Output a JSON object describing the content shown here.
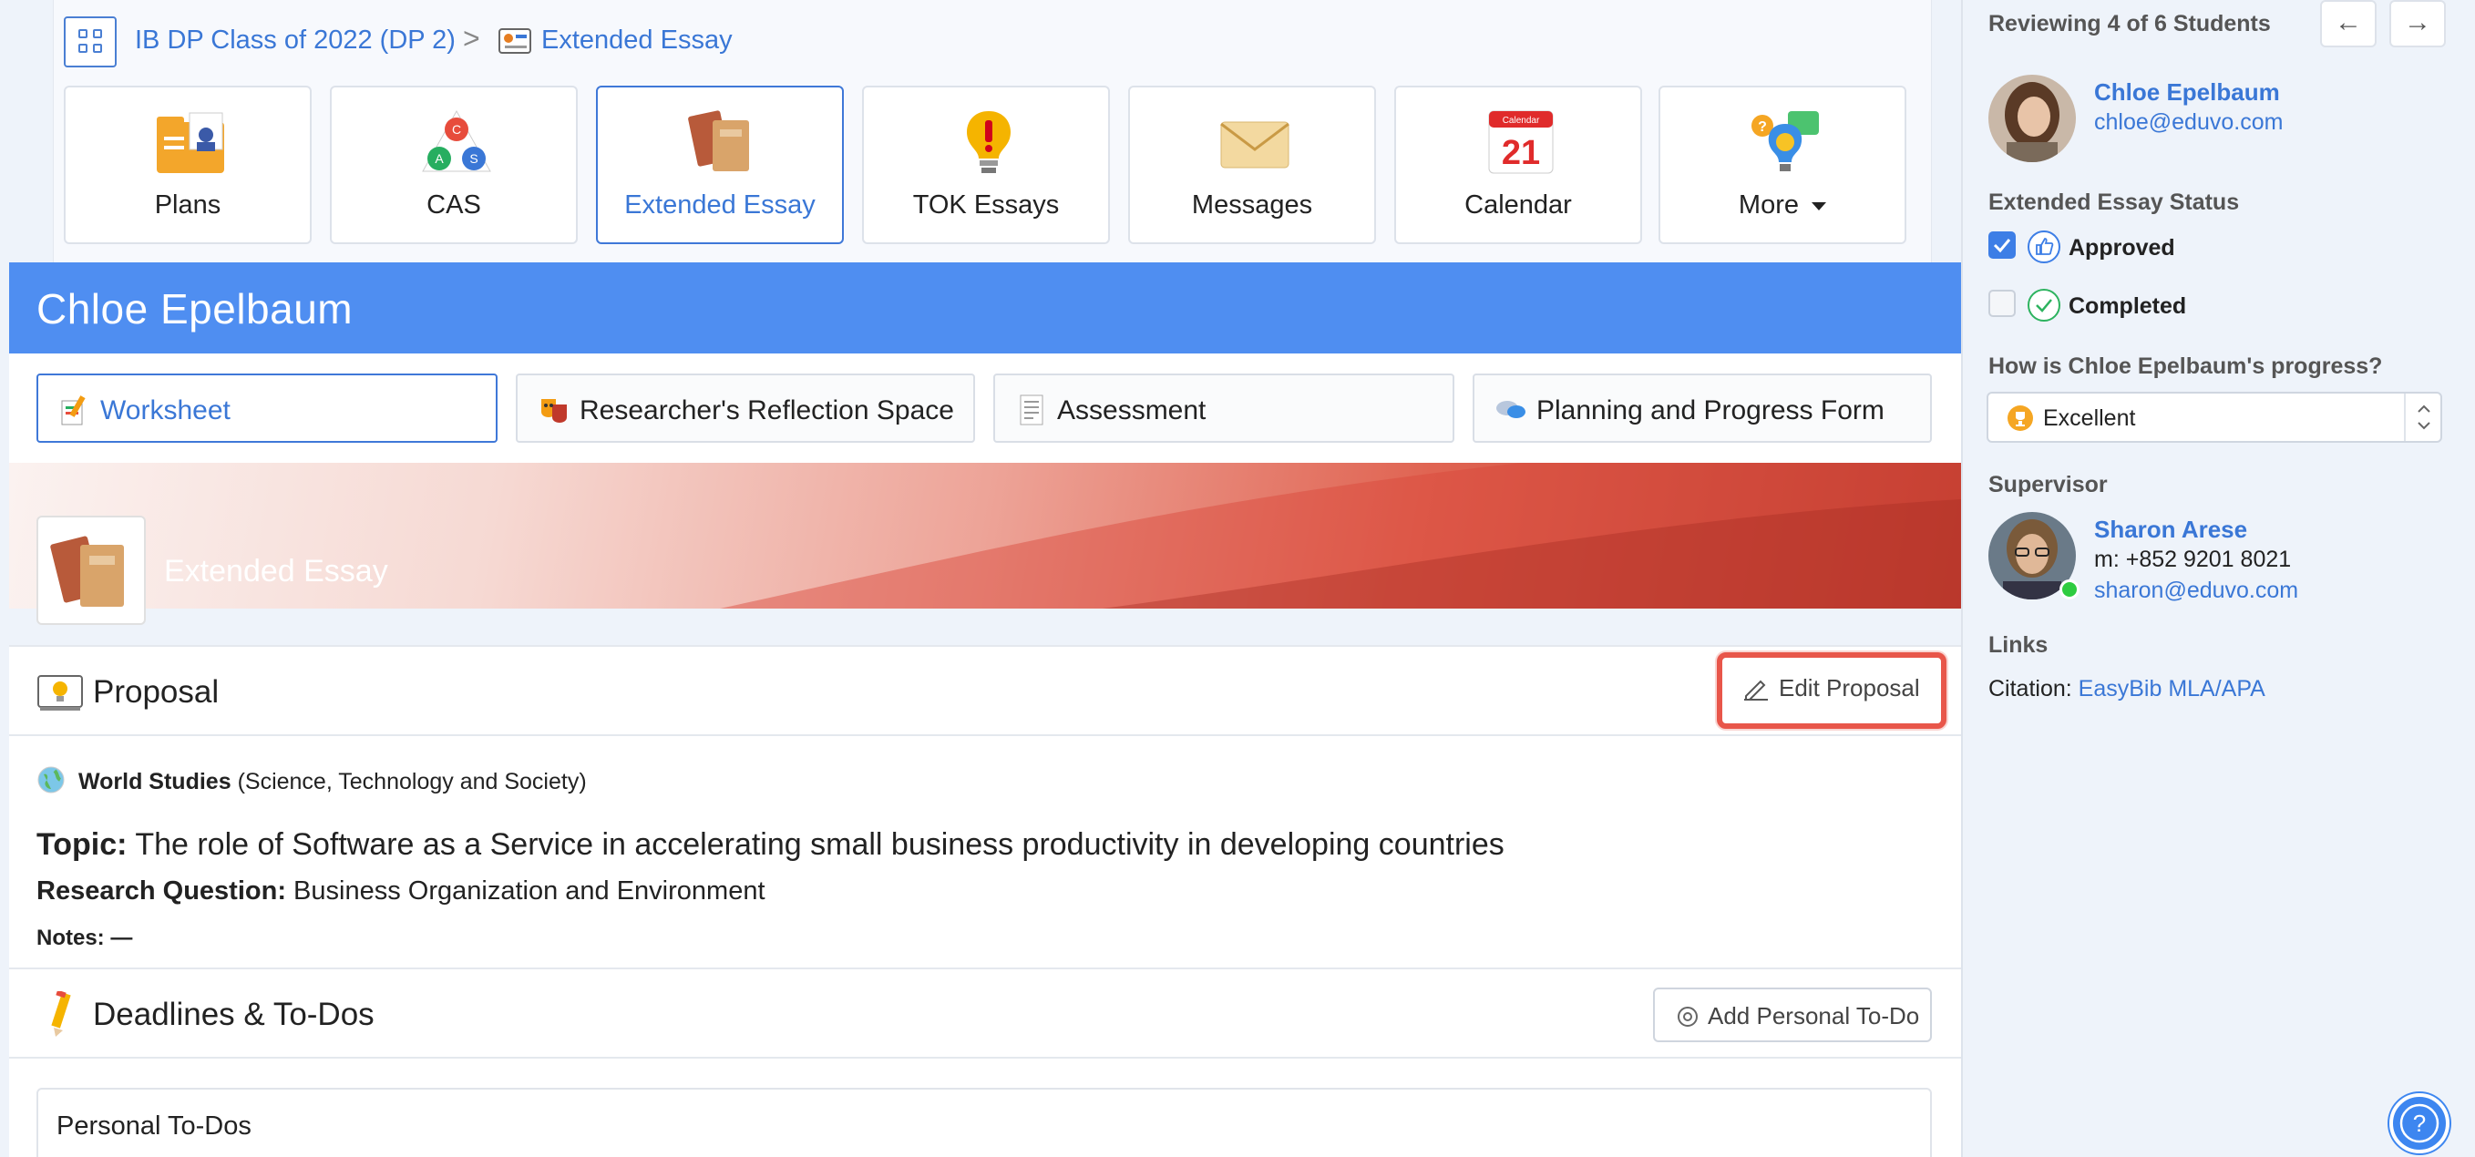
{
  "breadcrumb": {
    "class_name": "IB DP Class of 2022 (DP 2)",
    "current": "Extended Essay",
    "separator": ">"
  },
  "app_tiles": [
    {
      "label": "Plans",
      "icon": "plans-folder-icon"
    },
    {
      "label": "CAS",
      "icon": "cas-triangle-icon",
      "icon_letters": [
        "C",
        "A",
        "S"
      ]
    },
    {
      "label": "Extended Essay",
      "icon": "extended-essay-books-icon",
      "active": true
    },
    {
      "label": "TOK Essays",
      "icon": "lightbulb-exclamation-icon"
    },
    {
      "label": "Messages",
      "icon": "envelope-icon"
    },
    {
      "label": "Calendar",
      "icon": "calendar-icon",
      "icon_text": "21",
      "icon_header": "Calendar"
    },
    {
      "label": "More",
      "icon": "more-apps-icon",
      "has_dropdown": true
    }
  ],
  "student": {
    "name": "Chloe Epelbaum"
  },
  "subtabs": [
    {
      "label": "Worksheet",
      "icon": "worksheet-icon",
      "active": true
    },
    {
      "label": "Researcher's Reflection Space",
      "icon": "reflection-theater-icon"
    },
    {
      "label": "Assessment",
      "icon": "assessment-doc-icon"
    },
    {
      "label": "Planning and Progress Form",
      "icon": "speech-bubbles-icon"
    }
  ],
  "ee_header": {
    "title": "Extended Essay"
  },
  "proposal": {
    "title": "Proposal",
    "edit_label": "Edit Proposal",
    "subject": "World Studies",
    "subject_detail": "(Science, Technology and Society)",
    "topic_label": "Topic:",
    "topic": "The role of Software as a Service in accelerating small business productivity in developing countries",
    "rq_label": "Research Question:",
    "rq": "Business Organization and Environment",
    "notes_label": "Notes:",
    "notes": "—"
  },
  "deadlines": {
    "title": "Deadlines & To-Dos",
    "add_label": "Add Personal To-Do",
    "personal_todos_label": "Personal To-Dos"
  },
  "sidebar": {
    "reviewing": "Reviewing 4 of 6 Students",
    "prev_arrow": "←",
    "next_arrow": "→",
    "student_name": "Chloe Epelbaum",
    "student_email": "chloe@eduvo.com",
    "status_label": "Extended Essay Status",
    "approved_label": "Approved",
    "approved_checked": true,
    "completed_label": "Completed",
    "completed_checked": false,
    "progress_question": "How is Chloe Epelbaum's progress?",
    "progress_value": "Excellent",
    "supervisor_label": "Supervisor",
    "supervisor_name": "Sharon Arese",
    "supervisor_phone": "m: +852 9201 8021",
    "supervisor_email": "sharon@eduvo.com",
    "links_label": "Links",
    "citation_label": "Citation:",
    "citation_link": "EasyBib MLA/APA"
  },
  "colors": {
    "accent": "#3a77d6",
    "banner": "#4f8ef1",
    "highlight_border": "#e8564a",
    "online": "#2ecc40"
  }
}
